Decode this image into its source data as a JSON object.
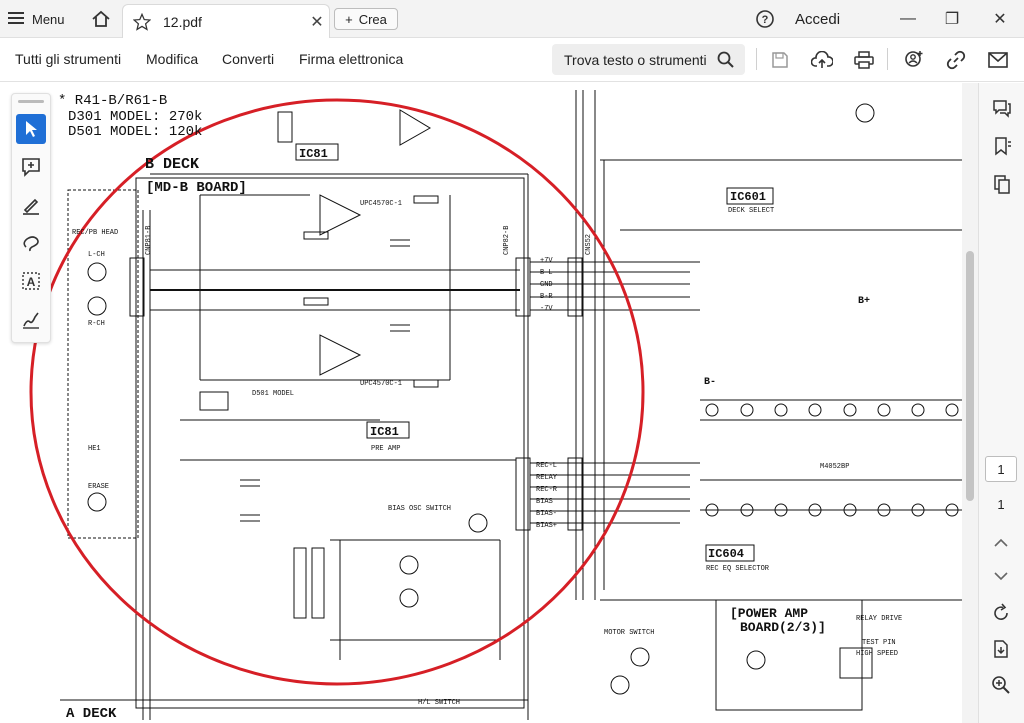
{
  "titlebar": {
    "menu_label": "Menu",
    "tab_title": "12.pdf",
    "new_button_label": "Crea",
    "signin_label": "Accedi",
    "window_controls": [
      "minimize",
      "restore",
      "close"
    ]
  },
  "toolbar": {
    "links": [
      "Tutti gli strumenti",
      "Modifica",
      "Converti",
      "Firma elettronica"
    ],
    "search_label": "Trova testo o strumenti",
    "icons": [
      "save-icon",
      "upload-icon",
      "print-icon",
      "share-user-icon",
      "link-icon",
      "mail-icon"
    ]
  },
  "left_tools": [
    "select-icon",
    "comment-add-icon",
    "highlight-pen-icon",
    "lasso-draw-icon",
    "text-select-icon",
    "sign-icon"
  ],
  "right_panel": {
    "icons": [
      "comments-icon",
      "bookmark-icon",
      "pages-icon"
    ],
    "page_current": "1",
    "page_total": "1",
    "bottom_icons": [
      "chevron-up-icon",
      "chevron-down-icon",
      "rotate-icon",
      "extract-icon",
      "zoom-in-icon"
    ]
  },
  "schematic": {
    "note_lines": [
      "* R41-B/R61-B",
      "D301 MODEL: 270k",
      "D501 MODEL: 120k"
    ],
    "labels": {
      "b_deck": "B DECK",
      "md_board": "[MD-B BOARD]",
      "a_deck": "A DECK",
      "ic81_top": "IC81",
      "ic81_mid": "IC81",
      "ic81_sub": "PRE AMP",
      "ic601": "IC601",
      "deck_select": "DECK SELECT",
      "ic604": "IC604",
      "rec_eq": "REC EQ SELECTOR",
      "power_amp": "[POWER AMP",
      "board23": "BOARD(2/3)]",
      "relay_drive": "RELAY DRIVE",
      "test_pin": "TEST PIN",
      "high_speed": "HIGH SPEED",
      "motor_switch": "MOTOR SWITCH",
      "rp_head": "REC/PB HEAD",
      "lch": "L-CH",
      "rch": "R-CH",
      "erase": "ERASE",
      "he1": "HE1",
      "bias_osc": "BIAS OSC SWITCH",
      "d501_model": "D501 MODEL",
      "dummy": "D501 MODEL",
      "upc_a": "UPC4570C-1",
      "upc_b": "UPC4570C-1",
      "ic604_part": "M4052BP",
      "hl_switch": "H/L SWITCH",
      "plus7v": "+7V",
      "b_l": "B-L",
      "gnd": "GND",
      "b_r": "B-R",
      "minus7v": "-7V",
      "rec_l": "REC-L",
      "relay": "RELAY",
      "rec_r": "REC-R",
      "bias": "BIAS",
      "bias_minus": "BIAS-",
      "bias_plus": "BIAS+",
      "b_plus": "B+",
      "b_minus": "B-",
      "cnp82": "CNP82-B",
      "cns52": "CNS52",
      "cnp81": "CNP81-B"
    }
  }
}
